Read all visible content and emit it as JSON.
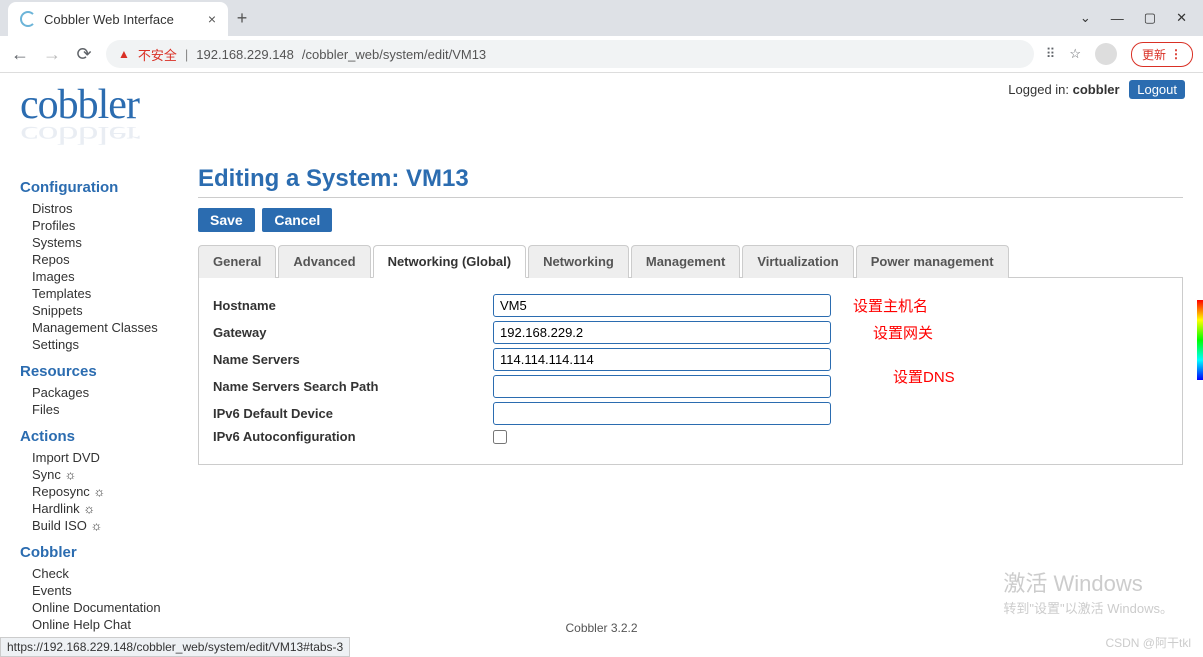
{
  "browser": {
    "tab_title": "Cobbler Web Interface",
    "insecure_label": "不安全",
    "url_host": "192.168.229.148",
    "url_path": "/cobbler_web/system/edit/VM13",
    "update_label": "更新",
    "win_min": "—",
    "win_max": "▢",
    "win_close": "✕",
    "win_expand": "⌄"
  },
  "header": {
    "logged_in_prefix": "Logged in: ",
    "username": "cobbler",
    "logout": "Logout",
    "logo": "cobbler"
  },
  "sidebar": {
    "sections": [
      {
        "title": "Configuration",
        "items": [
          "Distros",
          "Profiles",
          "Systems",
          "Repos",
          "Images",
          "Templates",
          "Snippets",
          "Management Classes",
          "Settings"
        ]
      },
      {
        "title": "Resources",
        "items": [
          "Packages",
          "Files"
        ]
      },
      {
        "title": "Actions",
        "items": [
          "Import DVD",
          "Sync ☼",
          "Reposync ☼",
          "Hardlink ☼",
          "Build ISO ☼"
        ]
      },
      {
        "title": "Cobbler",
        "items": [
          "Check",
          "Events",
          "Online Documentation",
          "Online Help Chat"
        ]
      }
    ]
  },
  "content": {
    "title": "Editing a System: VM13",
    "save": "Save",
    "cancel": "Cancel",
    "tabs": [
      "General",
      "Advanced",
      "Networking (Global)",
      "Networking",
      "Management",
      "Virtualization",
      "Power management"
    ],
    "active_tab": 2,
    "form": {
      "hostname_label": "Hostname",
      "hostname_value": "VM5",
      "gateway_label": "Gateway",
      "gateway_value": "192.168.229.2",
      "nameservers_label": "Name Servers",
      "nameservers_value": "114.114.114.114",
      "searchpath_label": "Name Servers Search Path",
      "searchpath_value": "",
      "ipv6dev_label": "IPv6 Default Device",
      "ipv6dev_value": "",
      "ipv6auto_label": "IPv6 Autoconfiguration"
    },
    "annotations": {
      "hostname": "设置主机名",
      "gateway": "设置网关",
      "dns": "设置DNS"
    }
  },
  "footer": {
    "version": "Cobbler 3.2.2"
  },
  "status_bar": "https://192.168.229.148/cobbler_web/system/edit/VM13#tabs-3",
  "watermark": {
    "line1": "激活 Windows",
    "line2": "转到\"设置\"以激活 Windows。"
  },
  "csdn": "CSDN @阿干tkl"
}
